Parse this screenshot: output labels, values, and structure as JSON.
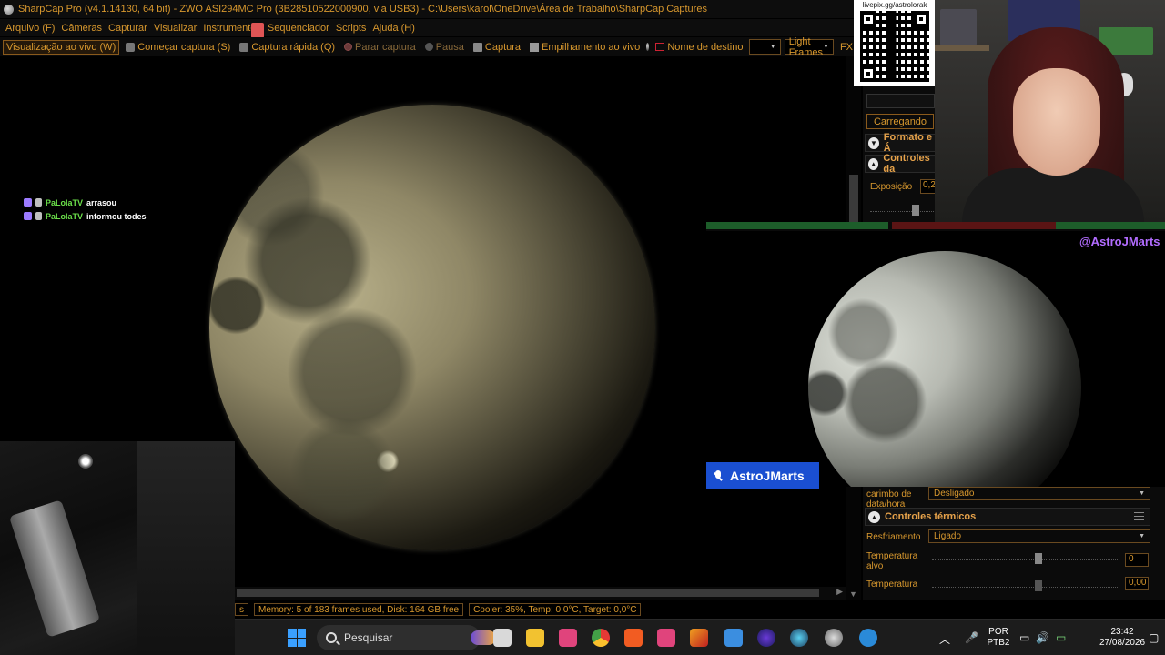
{
  "window": {
    "title": "SharpCap Pro (v4.1.14130, 64 bit) - ZWO ASI294MC Pro (3B28510522000900, via USB3) - C:\\Users\\karol\\OneDrive\\Área de Trabalho\\SharpCap Captures"
  },
  "menu": [
    "Arquivo (F)",
    "Câmeras",
    "Capturar",
    "Visualizar",
    "Instrumentos",
    "Sequenciador",
    "Scripts",
    "Ajuda (H)"
  ],
  "toolbar": {
    "live_view": "Visualização ao vivo (W)",
    "start_capture": "Começar captura (S)",
    "quick_capture": "Captura rápida (Q)",
    "stop_capture": "Parar captura",
    "pause": "Pausa",
    "snapshot": "Captura",
    "live_stack": "Empilhamento ao vivo",
    "target_name_label": "Nome de destino",
    "target_name_value": "",
    "frame_type": "Light Frames",
    "fx": "FX"
  },
  "chat": [
    {
      "user": "PaLolaTV",
      "message": "arrasou"
    },
    {
      "user": "PaLolaTV",
      "message": "informou todes"
    }
  ],
  "status": {
    "prefix": "s",
    "memory": "Memory: 5 of 183 frames used, Disk: 164 GB free",
    "cooler": "Cooler: 35%, Temp: 0,0°C, Target: 0,0°C"
  },
  "panel": {
    "loading_button": "Carregando",
    "section_format": "Formato e Á",
    "section_controls": "Controles da",
    "exposure_label": "Exposição",
    "exposure_value": "0,2",
    "timestamp_label": "carimbo de data/hora",
    "timestamp_value": "Desligado",
    "thermal_section": "Controles térmicos",
    "cooling_label": "Resfriamento",
    "cooling_value": "Ligado",
    "target_temp_label": "Temperatura alvo",
    "target_temp_value": "0",
    "temperature_label": "Temperatura",
    "temperature_value": "0,00"
  },
  "overlays": {
    "qr_url": "livepix.gg/astrolorak",
    "handle": "@AstroJMarts",
    "streamer_name": "AstroJMarts"
  },
  "taskbar": {
    "search_placeholder": "Pesquisar",
    "lang_top": "POR",
    "lang_bottom": "PTB2",
    "time": "23:42",
    "date": "27/08/2026"
  },
  "colors": {
    "accent": "#e6a24a",
    "chat_user": "#6be04a",
    "handle": "#b26cff",
    "twitch_bar": "#1a4fd1"
  }
}
